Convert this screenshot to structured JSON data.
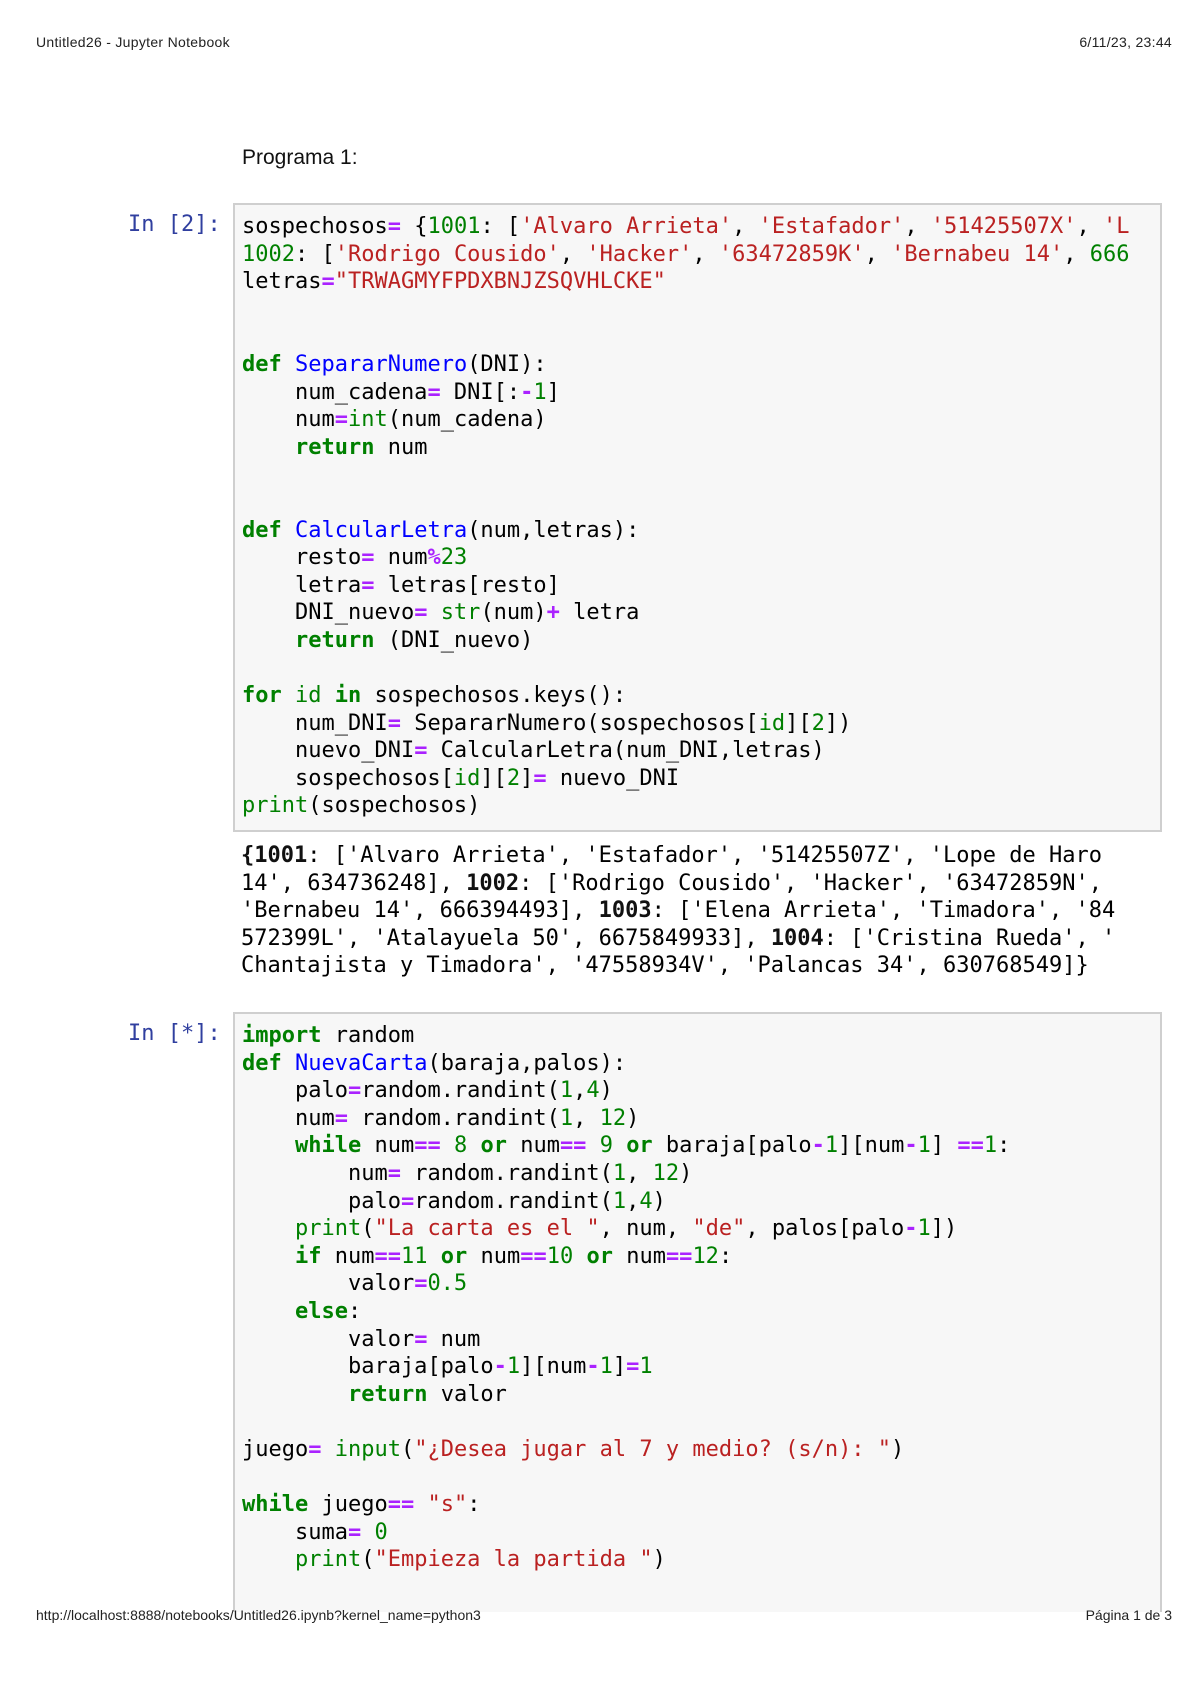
{
  "header": {
    "title": "Untitled26 - Jupyter Notebook",
    "datetime": "6/11/23, 23:44"
  },
  "footer": {
    "url": "http://localhost:8888/notebooks/Untitled26.ipynb?kernel_name=python3",
    "page": "Página 1 de 3"
  },
  "markdown": {
    "text": "Programa 1:"
  },
  "colors": {
    "keyword": "#008000",
    "string": "#ba2121",
    "operator": "#aa22ff",
    "function": "#0000ff",
    "prompt": "#303f9f"
  },
  "cells": [
    {
      "prompt": "In [2]:",
      "lines": [
        [
          [
            "t",
            "sospechosos"
          ],
          [
            "o",
            "="
          ],
          [
            "t",
            " {"
          ],
          [
            "n",
            "1001"
          ],
          [
            "t",
            ": ["
          ],
          [
            "s",
            "'Alvaro Arrieta'"
          ],
          [
            "t",
            ", "
          ],
          [
            "s",
            "'Estafador'"
          ],
          [
            "t",
            ", "
          ],
          [
            "s",
            "'51425507X'"
          ],
          [
            "t",
            ", "
          ],
          [
            "s",
            "'L"
          ]
        ],
        [
          [
            "n",
            "1002"
          ],
          [
            "t",
            ": ["
          ],
          [
            "s",
            "'Rodrigo Cousido'"
          ],
          [
            "t",
            ", "
          ],
          [
            "s",
            "'Hacker'"
          ],
          [
            "t",
            ", "
          ],
          [
            "s",
            "'63472859K'"
          ],
          [
            "t",
            ", "
          ],
          [
            "s",
            "'Bernabeu 14'"
          ],
          [
            "t",
            ", "
          ],
          [
            "n",
            "666"
          ]
        ],
        [
          [
            "t",
            "letras"
          ],
          [
            "o",
            "="
          ],
          [
            "s",
            "\"TRWAGMYFPDXBNJZSQVHLCKE\""
          ]
        ],
        [],
        [],
        [
          [
            "k",
            "def"
          ],
          [
            "t",
            " "
          ],
          [
            "f",
            "SepararNumero"
          ],
          [
            "t",
            "(DNI):"
          ]
        ],
        [
          [
            "t",
            "    num_cadena"
          ],
          [
            "o",
            "="
          ],
          [
            "t",
            " DNI[:"
          ],
          [
            "o",
            "-"
          ],
          [
            "n",
            "1"
          ],
          [
            "t",
            "]"
          ]
        ],
        [
          [
            "t",
            "    num"
          ],
          [
            "o",
            "="
          ],
          [
            "b",
            "int"
          ],
          [
            "t",
            "(num_cadena)"
          ]
        ],
        [
          [
            "t",
            "    "
          ],
          [
            "k",
            "return"
          ],
          [
            "t",
            " num"
          ]
        ],
        [],
        [],
        [
          [
            "k",
            "def"
          ],
          [
            "t",
            " "
          ],
          [
            "f",
            "CalcularLetra"
          ],
          [
            "t",
            "(num,letras):"
          ]
        ],
        [
          [
            "t",
            "    resto"
          ],
          [
            "o",
            "="
          ],
          [
            "t",
            " num"
          ],
          [
            "o",
            "%"
          ],
          [
            "n",
            "23"
          ]
        ],
        [
          [
            "t",
            "    letra"
          ],
          [
            "o",
            "="
          ],
          [
            "t",
            " letras[resto]"
          ]
        ],
        [
          [
            "t",
            "    DNI_nuevo"
          ],
          [
            "o",
            "="
          ],
          [
            "t",
            " "
          ],
          [
            "b",
            "str"
          ],
          [
            "t",
            "(num)"
          ],
          [
            "o",
            "+"
          ],
          [
            "t",
            " letra"
          ]
        ],
        [
          [
            "t",
            "    "
          ],
          [
            "k",
            "return"
          ],
          [
            "t",
            " (DNI_nuevo)"
          ]
        ],
        [],
        [
          [
            "k",
            "for"
          ],
          [
            "t",
            " "
          ],
          [
            "b",
            "id"
          ],
          [
            "t",
            " "
          ],
          [
            "k",
            "in"
          ],
          [
            "t",
            " sospechosos.keys():"
          ]
        ],
        [
          [
            "t",
            "    num_DNI"
          ],
          [
            "o",
            "="
          ],
          [
            "t",
            " SepararNumero(sospechosos["
          ],
          [
            "b",
            "id"
          ],
          [
            "t",
            "]["
          ],
          [
            "n",
            "2"
          ],
          [
            "t",
            "])"
          ]
        ],
        [
          [
            "t",
            "    nuevo_DNI"
          ],
          [
            "o",
            "="
          ],
          [
            "t",
            " CalcularLetra(num_DNI,letras)"
          ]
        ],
        [
          [
            "t",
            "    sospechosos["
          ],
          [
            "b",
            "id"
          ],
          [
            "t",
            "]["
          ],
          [
            "n",
            "2"
          ],
          [
            "t",
            "]"
          ],
          [
            "o",
            "="
          ],
          [
            "t",
            " nuevo_DNI"
          ]
        ],
        [
          [
            "b",
            "print"
          ],
          [
            "t",
            "(sospechosos)"
          ]
        ]
      ],
      "output": [
        [
          [
            "ob",
            "{1001"
          ],
          [
            "t",
            ": ['Alvaro Arrieta', 'Estafador', '51425507Z', 'Lope de Haro"
          ]
        ],
        [
          [
            "t",
            "14', 634736248], "
          ],
          [
            "ob",
            "1002"
          ],
          [
            "t",
            ": ['Rodrigo Cousido', 'Hacker', '63472859N',"
          ]
        ],
        [
          [
            "t",
            "'Bernabeu 14', 666394493], "
          ],
          [
            "ob",
            "1003"
          ],
          [
            "t",
            ": ['Elena Arrieta', 'Timadora', '84"
          ]
        ],
        [
          [
            "t",
            "572399L', 'Atalayuela 50', 6675849933], "
          ],
          [
            "ob",
            "1004"
          ],
          [
            "t",
            ": ['Cristina Rueda', '"
          ]
        ],
        [
          [
            "t",
            "Chantajista y Timadora', '47558934V', 'Palancas 34', 630768549]}"
          ]
        ]
      ]
    },
    {
      "prompt": "In [*]:",
      "lines": [
        [
          [
            "k",
            "import"
          ],
          [
            "t",
            " random"
          ]
        ],
        [
          [
            "k",
            "def"
          ],
          [
            "t",
            " "
          ],
          [
            "f",
            "NuevaCarta"
          ],
          [
            "t",
            "(baraja,palos):"
          ]
        ],
        [
          [
            "t",
            "    palo"
          ],
          [
            "o",
            "="
          ],
          [
            "t",
            "random.randint("
          ],
          [
            "n",
            "1"
          ],
          [
            "t",
            ","
          ],
          [
            "n",
            "4"
          ],
          [
            "t",
            ")"
          ]
        ],
        [
          [
            "t",
            "    num"
          ],
          [
            "o",
            "="
          ],
          [
            "t",
            " random.randint("
          ],
          [
            "n",
            "1"
          ],
          [
            "t",
            ", "
          ],
          [
            "n",
            "12"
          ],
          [
            "t",
            ")"
          ]
        ],
        [
          [
            "t",
            "    "
          ],
          [
            "k",
            "while"
          ],
          [
            "t",
            " num"
          ],
          [
            "o",
            "=="
          ],
          [
            "t",
            " "
          ],
          [
            "n",
            "8"
          ],
          [
            "t",
            " "
          ],
          [
            "k",
            "or"
          ],
          [
            "t",
            " num"
          ],
          [
            "o",
            "=="
          ],
          [
            "t",
            " "
          ],
          [
            "n",
            "9"
          ],
          [
            "t",
            " "
          ],
          [
            "k",
            "or"
          ],
          [
            "t",
            " baraja[palo"
          ],
          [
            "o",
            "-"
          ],
          [
            "n",
            "1"
          ],
          [
            "t",
            "][num"
          ],
          [
            "o",
            "-"
          ],
          [
            "n",
            "1"
          ],
          [
            "t",
            "] "
          ],
          [
            "o",
            "=="
          ],
          [
            "n",
            "1"
          ],
          [
            "t",
            ":"
          ]
        ],
        [
          [
            "t",
            "        num"
          ],
          [
            "o",
            "="
          ],
          [
            "t",
            " random.randint("
          ],
          [
            "n",
            "1"
          ],
          [
            "t",
            ", "
          ],
          [
            "n",
            "12"
          ],
          [
            "t",
            ")"
          ]
        ],
        [
          [
            "t",
            "        palo"
          ],
          [
            "o",
            "="
          ],
          [
            "t",
            "random.randint("
          ],
          [
            "n",
            "1"
          ],
          [
            "t",
            ","
          ],
          [
            "n",
            "4"
          ],
          [
            "t",
            ")"
          ]
        ],
        [
          [
            "t",
            "    "
          ],
          [
            "b",
            "print"
          ],
          [
            "t",
            "("
          ],
          [
            "s",
            "\"La carta es el \""
          ],
          [
            "t",
            ", num, "
          ],
          [
            "s",
            "\"de\""
          ],
          [
            "t",
            ", palos[palo"
          ],
          [
            "o",
            "-"
          ],
          [
            "n",
            "1"
          ],
          [
            "t",
            "])"
          ]
        ],
        [
          [
            "t",
            "    "
          ],
          [
            "k",
            "if"
          ],
          [
            "t",
            " num"
          ],
          [
            "o",
            "=="
          ],
          [
            "n",
            "11"
          ],
          [
            "t",
            " "
          ],
          [
            "k",
            "or"
          ],
          [
            "t",
            " num"
          ],
          [
            "o",
            "=="
          ],
          [
            "n",
            "10"
          ],
          [
            "t",
            " "
          ],
          [
            "k",
            "or"
          ],
          [
            "t",
            " num"
          ],
          [
            "o",
            "=="
          ],
          [
            "n",
            "12"
          ],
          [
            "t",
            ":"
          ]
        ],
        [
          [
            "t",
            "        valor"
          ],
          [
            "o",
            "="
          ],
          [
            "n",
            "0.5"
          ]
        ],
        [
          [
            "t",
            "    "
          ],
          [
            "k",
            "else"
          ],
          [
            "t",
            ":"
          ]
        ],
        [
          [
            "t",
            "        valor"
          ],
          [
            "o",
            "="
          ],
          [
            "t",
            " num"
          ]
        ],
        [
          [
            "t",
            "        baraja[palo"
          ],
          [
            "o",
            "-"
          ],
          [
            "n",
            "1"
          ],
          [
            "t",
            "][num"
          ],
          [
            "o",
            "-"
          ],
          [
            "n",
            "1"
          ],
          [
            "t",
            "]"
          ],
          [
            "o",
            "="
          ],
          [
            "n",
            "1"
          ]
        ],
        [
          [
            "t",
            "        "
          ],
          [
            "k",
            "return"
          ],
          [
            "t",
            " valor"
          ]
        ],
        [],
        [
          [
            "t",
            "juego"
          ],
          [
            "o",
            "="
          ],
          [
            "t",
            " "
          ],
          [
            "b",
            "input"
          ],
          [
            "t",
            "("
          ],
          [
            "s",
            "\"¿Desea jugar al 7 y medio? (s/n): \""
          ],
          [
            "t",
            ")"
          ]
        ],
        [],
        [
          [
            "k",
            "while"
          ],
          [
            "t",
            " juego"
          ],
          [
            "o",
            "=="
          ],
          [
            "t",
            " "
          ],
          [
            "s",
            "\"s\""
          ],
          [
            "t",
            ":"
          ]
        ],
        [
          [
            "t",
            "    suma"
          ],
          [
            "o",
            "="
          ],
          [
            "t",
            " "
          ],
          [
            "n",
            "0"
          ]
        ],
        [
          [
            "t",
            "    "
          ],
          [
            "b",
            "print"
          ],
          [
            "t",
            "("
          ],
          [
            "s",
            "\"Empieza la partida \""
          ],
          [
            "t",
            ")"
          ]
        ]
      ]
    }
  ]
}
